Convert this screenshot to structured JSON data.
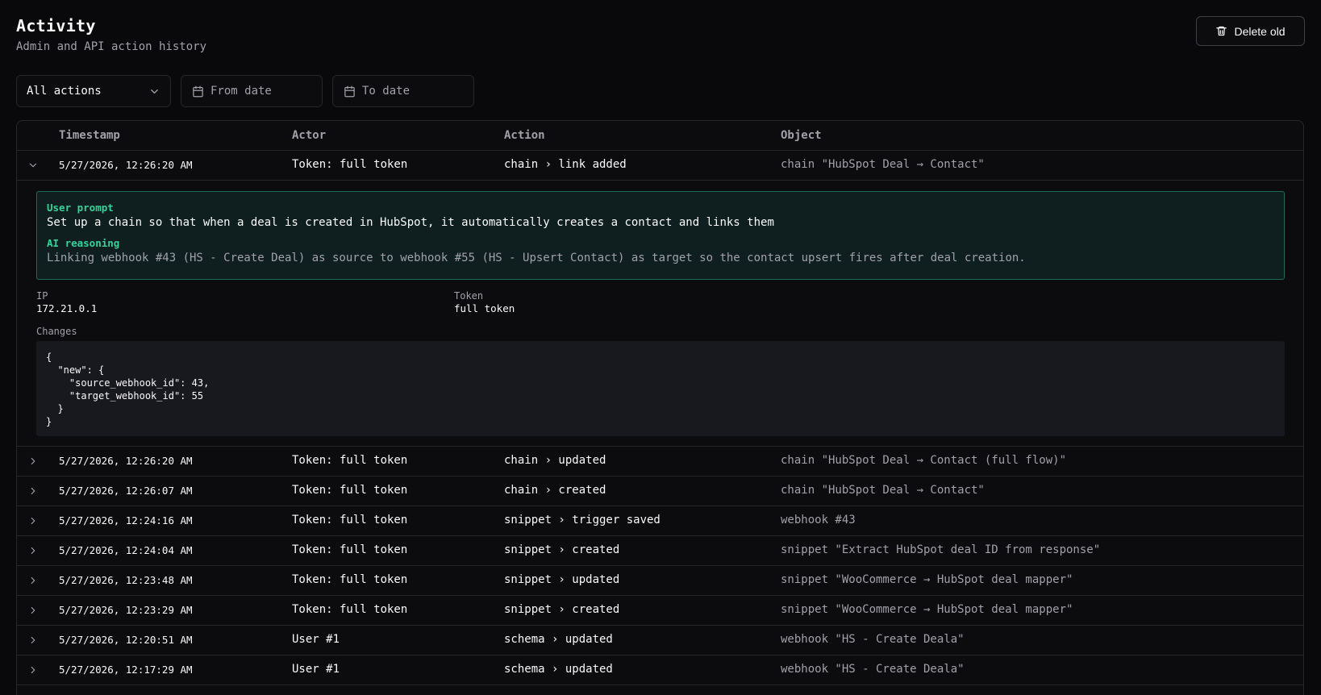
{
  "header": {
    "title": "Activity",
    "subtitle": "Admin and API action history",
    "delete_label": "Delete old"
  },
  "filters": {
    "action_select": "All actions",
    "from_placeholder": "From date",
    "to_placeholder": "To date"
  },
  "table": {
    "columns": {
      "timestamp": "Timestamp",
      "actor": "Actor",
      "action": "Action",
      "object": "Object"
    },
    "expanded_row": {
      "timestamp": "5/27/2026, 12:26:20 AM",
      "actor": "Token: full token",
      "action": "chain › link added",
      "object": "chain \"HubSpot Deal → Contact\"",
      "user_prompt_label": "User prompt",
      "user_prompt": "Set up a chain so that when a deal is created in HubSpot, it automatically creates a contact and links them",
      "ai_reasoning_label": "AI reasoning",
      "ai_reasoning": "Linking webhook #43 (HS - Create Deal) as source to webhook #55 (HS - Upsert Contact) as target so the contact upsert fires after deal creation.",
      "ip_label": "IP",
      "ip_value": "172.21.0.1",
      "token_label": "Token",
      "token_value": "full token",
      "changes_label": "Changes",
      "changes_json": "{\n  \"new\": {\n    \"source_webhook_id\": 43,\n    \"target_webhook_id\": 55\n  }\n}"
    },
    "rows": [
      {
        "timestamp": "5/27/2026, 12:26:20 AM",
        "actor": "Token: full token",
        "action": "chain › updated",
        "object": "chain \"HubSpot Deal → Contact (full flow)\""
      },
      {
        "timestamp": "5/27/2026, 12:26:07 AM",
        "actor": "Token: full token",
        "action": "chain › created",
        "object": "chain \"HubSpot Deal → Contact\""
      },
      {
        "timestamp": "5/27/2026, 12:24:16 AM",
        "actor": "Token: full token",
        "action": "snippet › trigger saved",
        "object": "webhook #43"
      },
      {
        "timestamp": "5/27/2026, 12:24:04 AM",
        "actor": "Token: full token",
        "action": "snippet › created",
        "object": "snippet \"Extract HubSpot deal ID from response\""
      },
      {
        "timestamp": "5/27/2026, 12:23:48 AM",
        "actor": "Token: full token",
        "action": "snippet › updated",
        "object": "snippet \"WooCommerce → HubSpot deal mapper\""
      },
      {
        "timestamp": "5/27/2026, 12:23:29 AM",
        "actor": "Token: full token",
        "action": "snippet › created",
        "object": "snippet \"WooCommerce → HubSpot deal mapper\""
      },
      {
        "timestamp": "5/27/2026, 12:20:51 AM",
        "actor": "User #1",
        "action": "schema › updated",
        "object": "webhook \"HS - Create Deala\""
      },
      {
        "timestamp": "5/27/2026, 12:17:29 AM",
        "actor": "User #1",
        "action": "schema › updated",
        "object": "webhook \"HS - Create Deala\""
      }
    ]
  }
}
